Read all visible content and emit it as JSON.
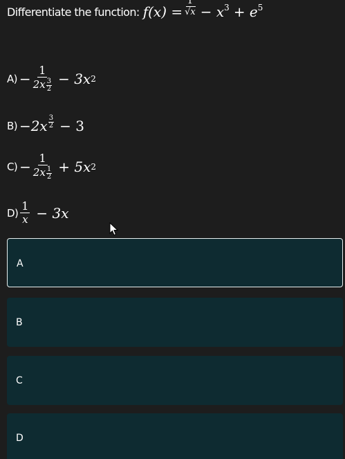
{
  "question": {
    "prefix": "Differentiate the function:",
    "lhs": "f(x) =",
    "num": "1",
    "sqrt_sign": "√",
    "den_var": "x",
    "rest": "− x",
    "exp3": "3",
    "plus_e": "+ e",
    "exp5": "5"
  },
  "options": {
    "a": {
      "letter": "A)",
      "lead": "−",
      "num": "1",
      "den": "2x",
      "exp_num": "3",
      "exp_den": "2",
      "tail": "− 3x",
      "tail_exp": "2"
    },
    "b": {
      "letter": "B)",
      "expr": "−2x",
      "exp_num": "3",
      "exp_den": "2",
      "tail": "− 3"
    },
    "c": {
      "letter": "C)",
      "lead": "−",
      "num": "1",
      "den": "2x",
      "exp_num": "1",
      "exp_den": "2",
      "tail": "+ 5x",
      "tail_exp": "2"
    },
    "d": {
      "letter": "D)",
      "num": "1",
      "den": "x",
      "tail": "− 3x"
    }
  },
  "choices": [
    {
      "label": "A",
      "selected": true
    },
    {
      "label": "B",
      "selected": false
    },
    {
      "label": "C",
      "selected": false
    },
    {
      "label": "D",
      "selected": false
    }
  ],
  "colors": {
    "background": "#1d1d1d",
    "choice_bg": "#0e2b31",
    "selected_border": "#e8f0f0"
  },
  "cursor_icon": "arrow-pointer"
}
